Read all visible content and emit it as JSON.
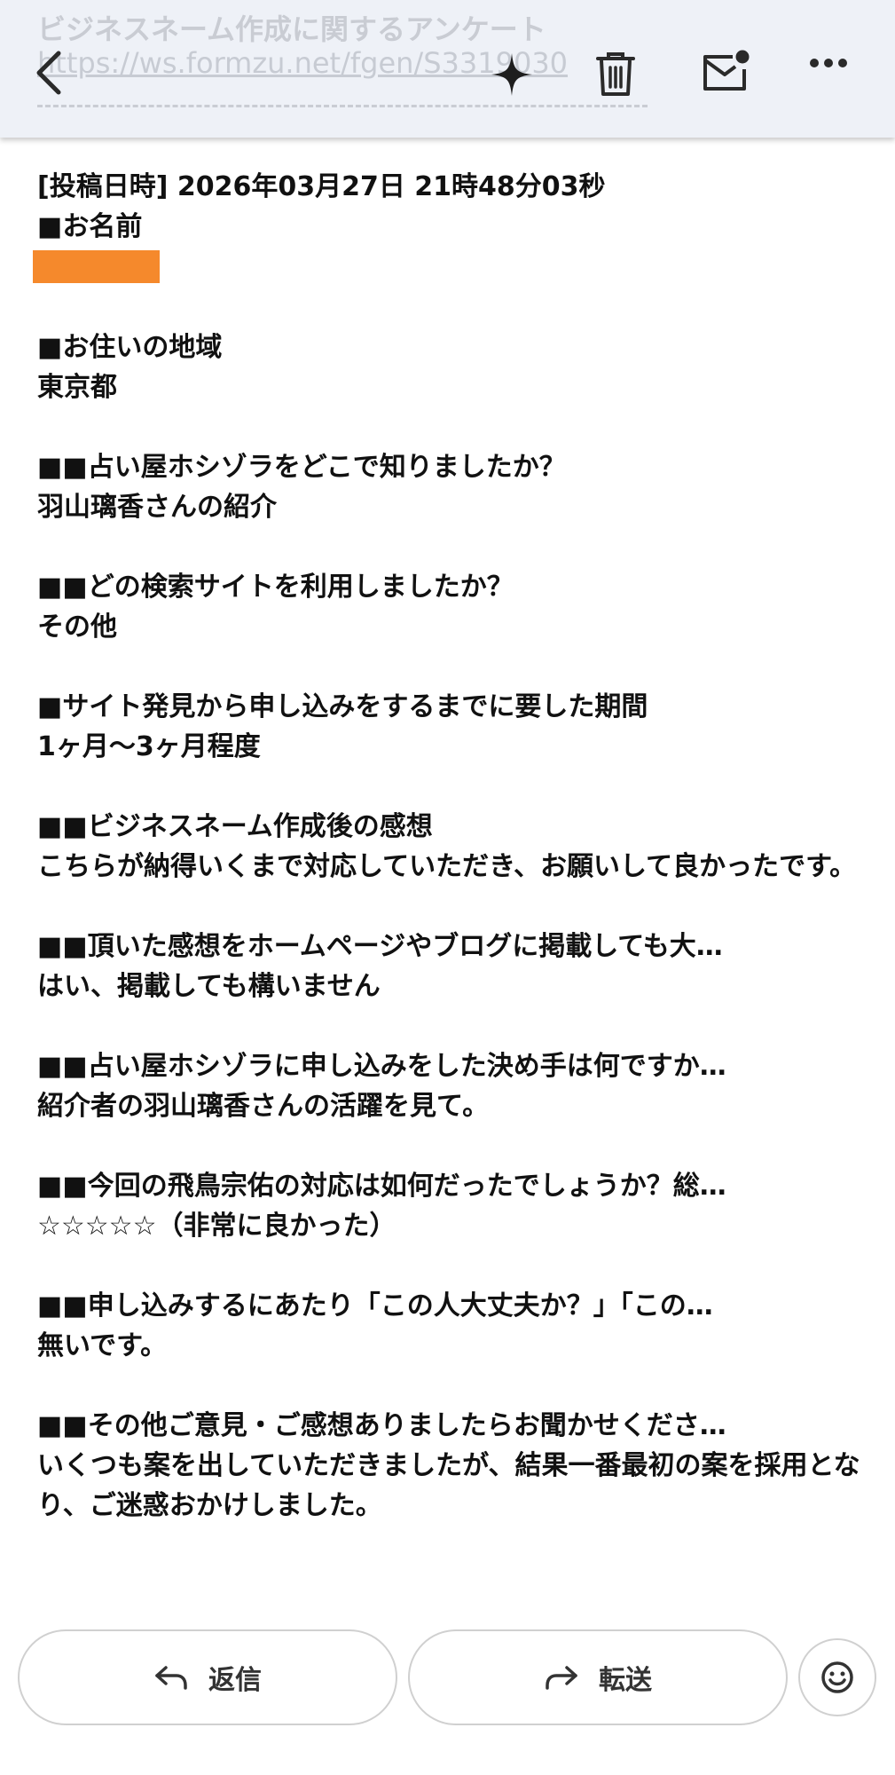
{
  "header": {
    "subject_behind": "ビジネスネーム作成に関するアンケート",
    "link_behind": "https://ws.formzu.net/fgen/S3319030",
    "icons": [
      "back-icon",
      "sparkle-icon",
      "trash-icon",
      "mail-unread-icon",
      "more-icon"
    ]
  },
  "message": {
    "posted": "[投稿日時] 2026年03月27日 21時48分03秒",
    "sections": [
      {
        "q": "■お名前",
        "a": ""
      },
      {
        "q": "■お住いの地域",
        "a": "東京都"
      },
      {
        "q": "■■占い屋ホシゾラをどこで知りましたか？",
        "a": "羽山璃香さんの紹介"
      },
      {
        "q": "■■どの検索サイトを利用しましたか？",
        "a": "その他"
      },
      {
        "q": "■サイト発見から申し込みをするまでに要した期間",
        "a": "1ヶ月〜3ヶ月程度"
      },
      {
        "q": "■■ビジネスネーム作成後の感想",
        "a": "こちらが納得いくまで対応していただき、お願いして良かったです。"
      },
      {
        "q": "■■頂いた感想をホームページやブログに掲載しても大…",
        "a": "はい、掲載しても構いません"
      },
      {
        "q": "■■占い屋ホシゾラに申し込みをした決め手は何ですか…",
        "a": "紹介者の羽山璃香さんの活躍を見て。"
      },
      {
        "q": "■■今回の飛鳥宗佑の対応は如何だったでしょうか？総…",
        "a": "☆☆☆☆☆（非常に良かった）"
      },
      {
        "q": "■■申し込みするにあたり「この人大丈夫か？」「この…",
        "a": "無いです。"
      },
      {
        "q": "■■その他ご意見・ご感想ありましたらお聞かせくださ…",
        "a": "いくつも案を出していただきましたが、結果一番最初の案を採用となり、ご迷惑おかけしました。"
      }
    ]
  },
  "actions": {
    "reply_label": "返信",
    "forward_label": "転送"
  },
  "colors": {
    "header_bg": "#eef1f7",
    "redaction": "#f5892c",
    "text": "#111111"
  }
}
